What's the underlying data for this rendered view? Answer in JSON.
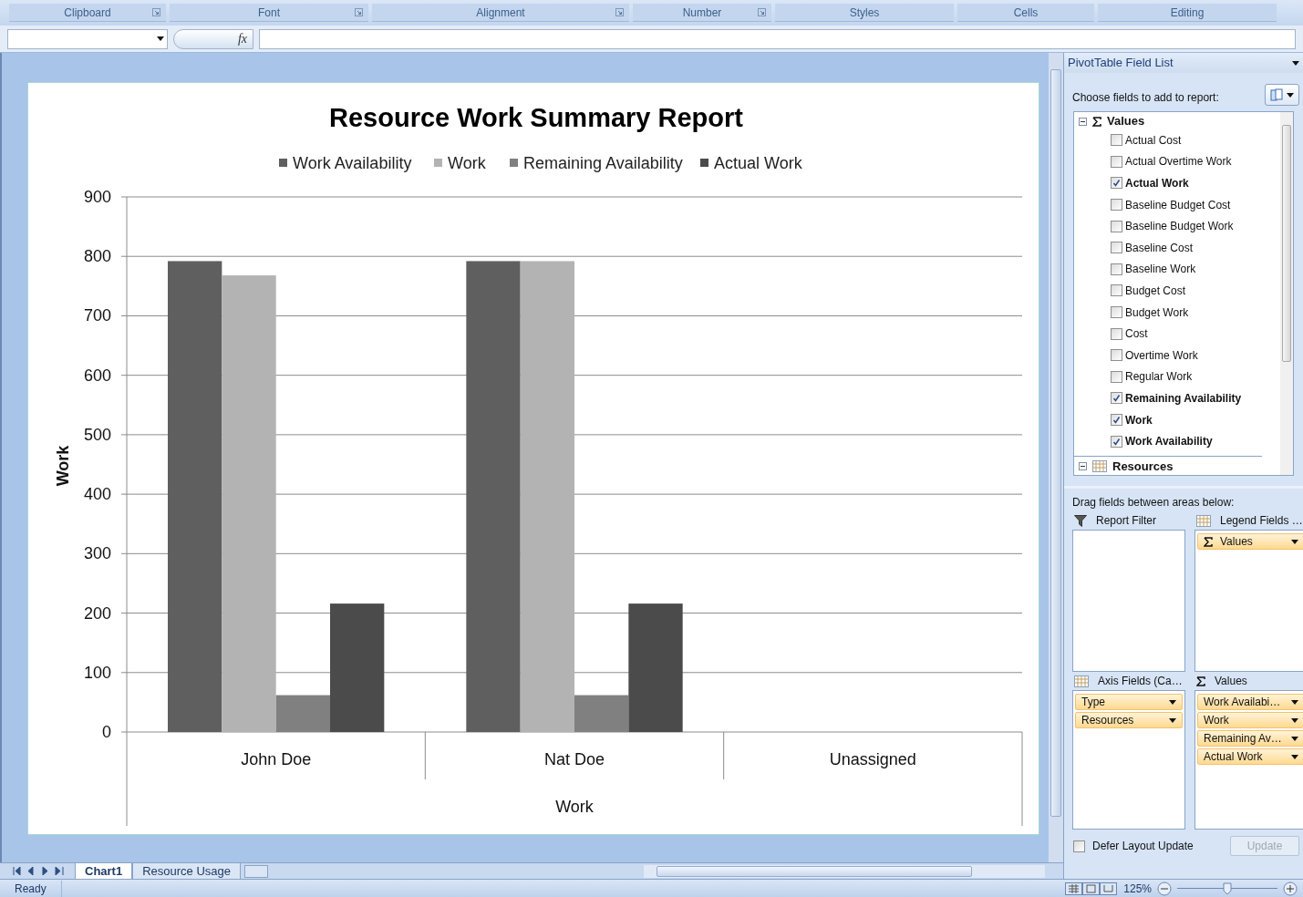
{
  "ribbon_groups": [
    {
      "label": "Clipboard",
      "launcher": true
    },
    {
      "label": "Font",
      "launcher": true
    },
    {
      "label": "Alignment",
      "launcher": true
    },
    {
      "label": "Number",
      "launcher": true
    },
    {
      "label": "Styles",
      "launcher": false
    },
    {
      "label": "Cells",
      "launcher": false
    },
    {
      "label": "Editing",
      "launcher": false
    }
  ],
  "formula_bar": {
    "fx": "fx"
  },
  "chart": {
    "title": "Resource Work Summary Report",
    "chart_data": {
      "type": "bar",
      "categories": [
        "John Doe",
        "Nat Doe",
        "Unassigned"
      ],
      "series": [
        {
          "name": "Work Availability",
          "color": "#5f5f5f",
          "values": [
            792,
            792,
            null
          ]
        },
        {
          "name": "Work",
          "color": "#b3b3b3",
          "values": [
            768,
            792,
            null
          ]
        },
        {
          "name": "Remaining Availability",
          "color": "#808080",
          "values": [
            62,
            62,
            null
          ]
        },
        {
          "name": "Actual Work",
          "color": "#4b4b4b",
          "values": [
            216,
            216,
            null
          ]
        }
      ],
      "grid": true,
      "legend": true,
      "ylim": [
        0,
        900
      ],
      "yticks": [
        0,
        100,
        200,
        300,
        400,
        500,
        600,
        700,
        800,
        900
      ],
      "ylabel": "Work",
      "xlabel": "Work"
    }
  },
  "field_list": {
    "title": "PivotTable Field List",
    "prompt": "Choose fields to add to report:",
    "groups": [
      {
        "label": "Values",
        "kind": "sigma",
        "expanded": true,
        "children": [
          {
            "label": "Actual Cost",
            "checked": false
          },
          {
            "label": "Actual Overtime Work",
            "checked": false
          },
          {
            "label": "Actual Work",
            "checked": true
          },
          {
            "label": "Baseline Budget Cost",
            "checked": false
          },
          {
            "label": "Baseline Budget Work",
            "checked": false
          },
          {
            "label": "Baseline Cost",
            "checked": false
          },
          {
            "label": "Baseline Work",
            "checked": false
          },
          {
            "label": "Budget Cost",
            "checked": false
          },
          {
            "label": "Budget Work",
            "checked": false
          },
          {
            "label": "Cost",
            "checked": false
          },
          {
            "label": "Overtime Work",
            "checked": false
          },
          {
            "label": "Regular Work",
            "checked": false
          },
          {
            "label": "Remaining Availability",
            "checked": true
          },
          {
            "label": "Work",
            "checked": true
          },
          {
            "label": "Work Availability",
            "checked": true
          }
        ]
      },
      {
        "label": "Resources",
        "kind": "table",
        "expanded": true
      }
    ],
    "areas_prompt": "Drag fields between areas below:",
    "areas": [
      {
        "label": "Report Filter",
        "kind": "filter"
      },
      {
        "label": "Legend Fields …",
        "kind": "table",
        "fields": [
          {
            "label": "Values",
            "kind": "sigma"
          }
        ]
      },
      {
        "label": "Axis Fields (Ca…",
        "kind": "table",
        "fields": [
          {
            "label": "Type",
            "kind": "plain"
          },
          {
            "label": "Resources",
            "kind": "plain"
          }
        ]
      },
      {
        "label": "Values",
        "kind": "sigma",
        "fields": [
          {
            "label": "Work Availabi…",
            "kind": "plain"
          },
          {
            "label": "Work",
            "kind": "plain"
          },
          {
            "label": "Remaining Av…",
            "kind": "plain"
          },
          {
            "label": "Actual Work",
            "kind": "plain"
          }
        ]
      }
    ],
    "defer": {
      "label": "Defer Layout Update",
      "checked": false
    },
    "update_button": {
      "label": "Update",
      "disabled": true
    }
  },
  "sheet_tabs": [
    {
      "label": "Chart1",
      "selected": true
    },
    {
      "label": "Resource Usage",
      "selected": false
    }
  ],
  "status_bar": {
    "text": "Ready",
    "zoom": "125%",
    "zoom_slider": {
      "level": 0.5
    }
  }
}
